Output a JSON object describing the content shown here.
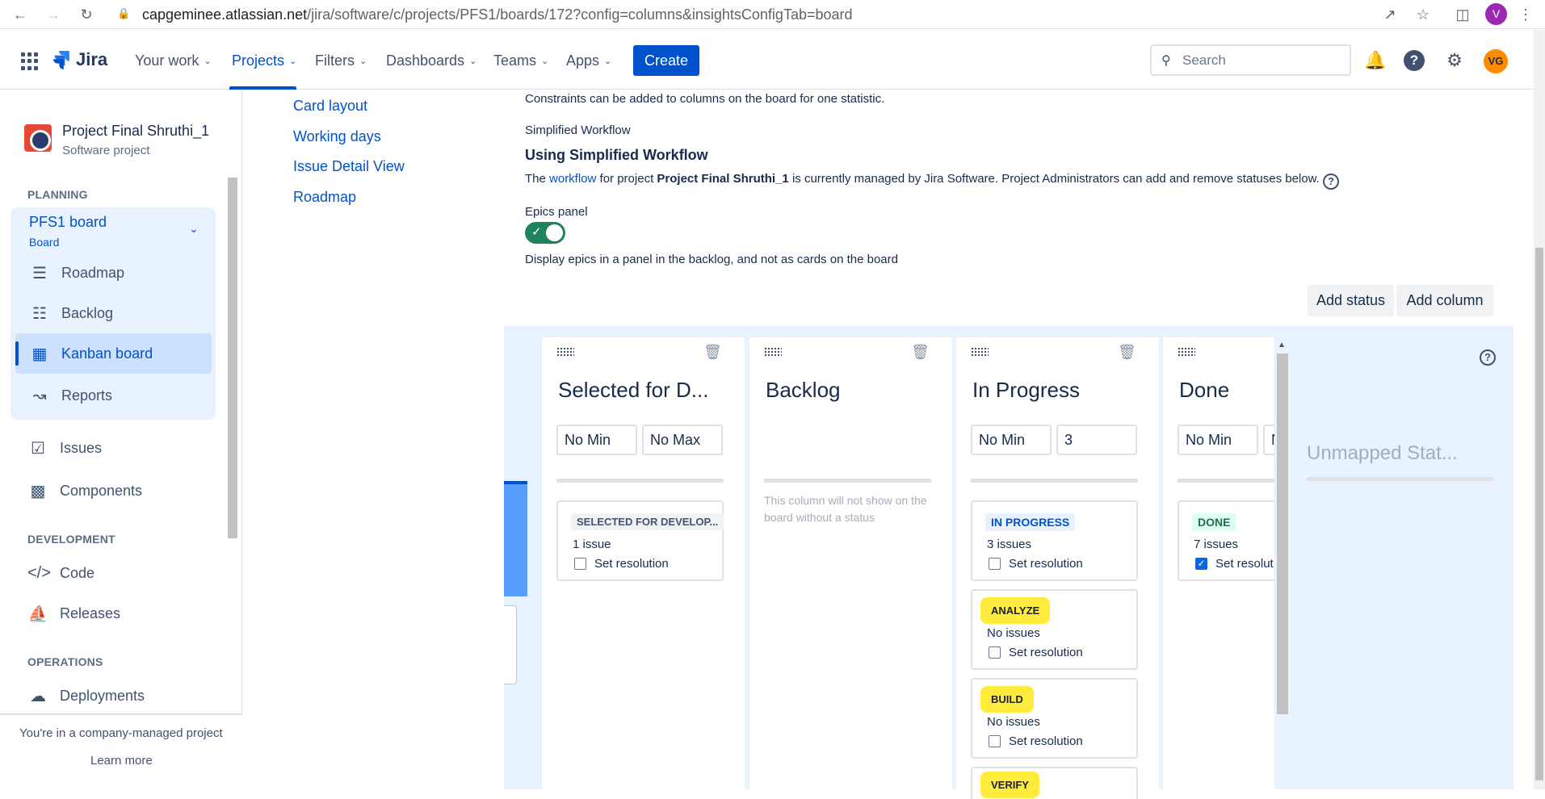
{
  "browser": {
    "url_host": "capgeminee.atlassian.net",
    "url_path": "/jira/software/c/projects/PFS1/boards/172?config=columns&insightsConfigTab=board",
    "profile_initial": "V"
  },
  "topnav": {
    "logo": "Jira",
    "items": [
      "Your work",
      "Projects",
      "Filters",
      "Dashboards",
      "Teams",
      "Apps"
    ],
    "create": "Create",
    "search_placeholder": "Search",
    "avatar": "VG"
  },
  "sidebar": {
    "project_name": "Project Final Shruthi_1",
    "project_type": "Software project",
    "planning_heading": "PLANNING",
    "board_name": "PFS1 board",
    "board_sub": "Board",
    "planning_items": [
      "Roadmap",
      "Backlog",
      "Kanban board",
      "Reports"
    ],
    "other_items": [
      "Issues",
      "Components"
    ],
    "development_heading": "DEVELOPMENT",
    "development_items": [
      "Code",
      "Releases"
    ],
    "operations_heading": "OPERATIONS",
    "operations_items": [
      "Deployments"
    ],
    "footer_text": "You're in a company-managed project",
    "footer_link": "Learn more"
  },
  "settings_menu": [
    "Card layout",
    "Working days",
    "Issue Detail View",
    "Roadmap"
  ],
  "main": {
    "constraints_text": "Constraints can be added to columns on the board for one statistic.",
    "simplified_label": "Simplified Workflow",
    "simplified_heading": "Using Simplified Workflow",
    "workflow_pre": "The ",
    "workflow_link": "workflow",
    "workflow_mid": " for project ",
    "workflow_project": "Project Final Shruthi_1",
    "workflow_post": " is currently managed by Jira Software. Project Administrators can add and remove statuses below.",
    "epics_label": "Epics panel",
    "epics_desc": "Display epics in a panel in the backlog, and not as cards on the board",
    "add_status": "Add status",
    "add_column": "Add column"
  },
  "columns": [
    {
      "title": "Selected for D...",
      "min": "No Min",
      "max": "No Max",
      "cards": [
        {
          "status": "SELECTED FOR DEVELOP...",
          "count": "1 issue",
          "resolution": "Set resolution",
          "checked": false
        }
      ]
    },
    {
      "title": "Backlog",
      "note": "This column will not show on the board without a status"
    },
    {
      "title": "In Progress",
      "min": "No Min",
      "max": "3",
      "cards": [
        {
          "status": "IN PROGRESS",
          "count": "3 issues",
          "resolution": "Set resolution",
          "checked": false
        },
        {
          "status": "ANALYZE",
          "count": "No issues",
          "resolution": "Set resolution",
          "checked": false
        },
        {
          "status": "BUILD",
          "count": "No issues",
          "resolution": "Set resolution",
          "checked": false
        },
        {
          "status": "VERIFY"
        }
      ]
    },
    {
      "title": "Done",
      "min": "No Min",
      "max": "N",
      "cards": [
        {
          "status": "DONE",
          "count": "7 issues",
          "resolution": "Set resolut",
          "checked": true
        }
      ]
    }
  ],
  "unmapped": "Unmapped Stat...",
  "colors": {
    "accent": "#0052cc",
    "highlight": "#ffeb3b",
    "toggle": "#1f845a"
  }
}
